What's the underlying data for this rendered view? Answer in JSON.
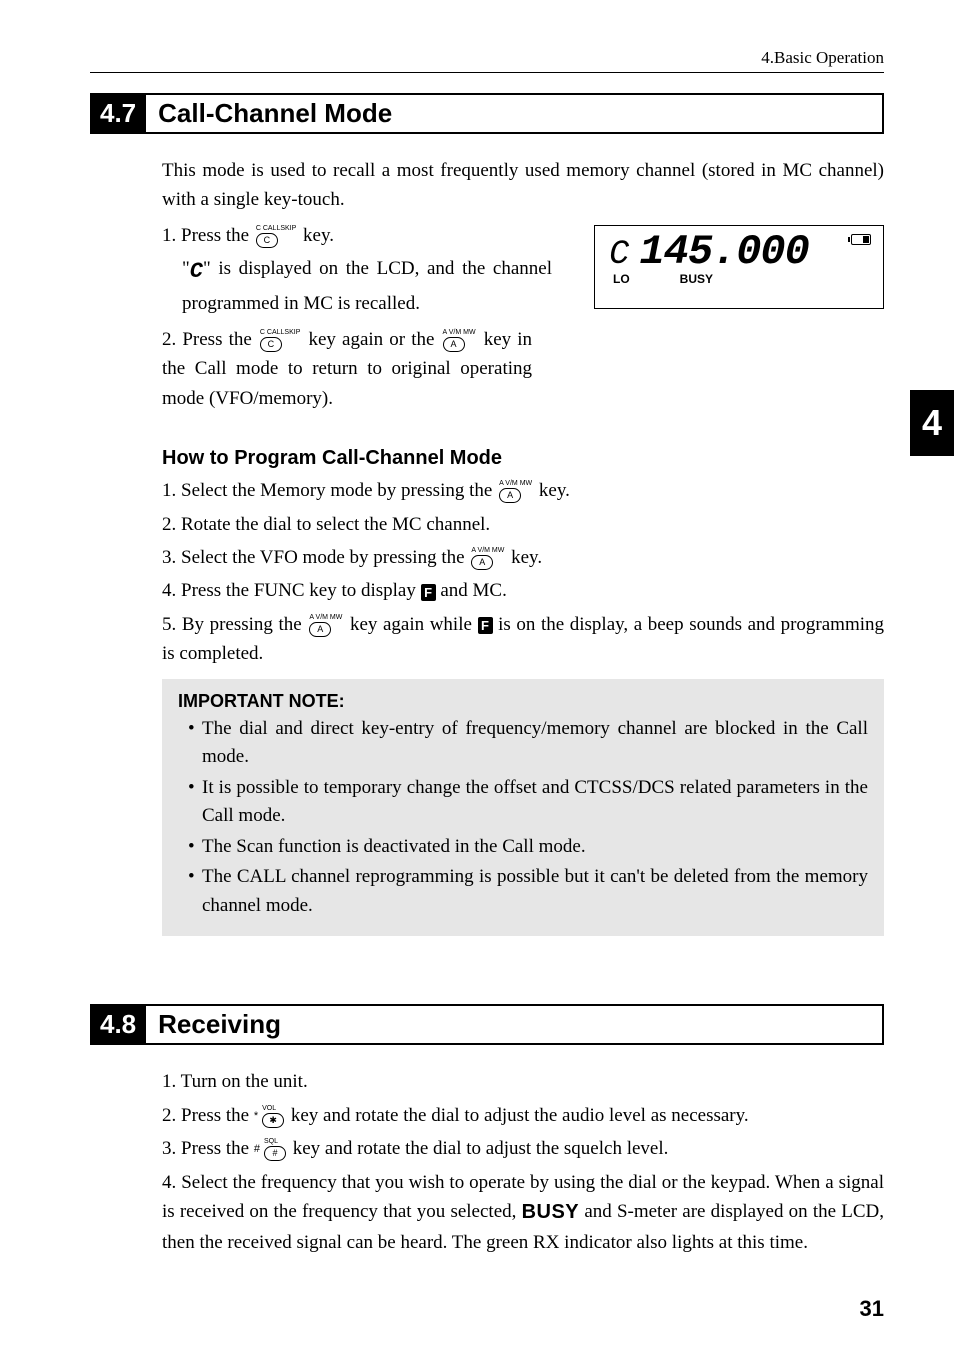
{
  "header": {
    "chapter_ref": "4.Basic Operation"
  },
  "chapter_tab": "4",
  "page_number": "31",
  "s47": {
    "number": "4.7",
    "title": "Call-Channel Mode",
    "intro": "This mode is used to recall a most frequently used memory channel (stored in MC channel) with a single key-touch.",
    "step1_a": "1. Press the ",
    "step1_b": " key.",
    "step1_sub_a": "\"",
    "step1_sub_b": "\" is displayed on the LCD, and the channel programmed in MC is recalled.",
    "step2_a": "2. Press the ",
    "step2_b": " key again or the ",
    "step2_c": " key in the Call mode to return to original operating mode (VFO/memory).",
    "lcd": {
      "c": "C",
      "freq": "145.000",
      "lo": "LO",
      "busy": "BUSY"
    },
    "howto_title": "How to Program Call-Channel Mode",
    "h1_a": "1. Select the Memory mode by pressing the ",
    "h1_b": " key.",
    "h2": "2. Rotate the dial to select the MC channel.",
    "h3_a": "3. Select the VFO mode by pressing the ",
    "h3_b": " key.",
    "h4_a": "4. Press the FUNC key to display ",
    "h4_b": " and MC.",
    "h5_a": "5. By pressing the ",
    "h5_b": " key again while ",
    "h5_c": " is on the display, a beep sounds and programming is completed.",
    "note_title": "IMPORTANT NOTE:",
    "note1": "The dial and direct key-entry of frequency/memory channel are blocked in the Call mode.",
    "note2": "It is possible to temporary change the offset and CTCSS/DCS related parameters in the Call mode.",
    "note3": "The Scan function is deactivated in the Call mode.",
    "note4": "The CALL channel reprogramming is possible but it can't be deleted from the memory channel mode."
  },
  "s48": {
    "number": "4.8",
    "title": "Receiving",
    "r1": "1. Turn on the unit.",
    "r2_a": "2. Press the ",
    "r2_b": " key and rotate the dial to adjust the audio level as necessary.",
    "r3_a": "3. Press the ",
    "r3_b": " key and rotate the dial to adjust the squelch level.",
    "r4_a": "4. Select the frequency that you wish to operate by using the dial or the keypad. When a signal is received on the frequency that you selected, ",
    "r4_b": " and S-meter are displayed on the LCD, then the received signal can be heard.  The green RX indicator also lights at this time.",
    "busy_label": "BUSY"
  },
  "keys": {
    "c_top": "C CALLSKIP",
    "c_inner": "C",
    "a_top": "A V/M MW",
    "a_inner": "A",
    "star_top": "VOL",
    "star_left": "*",
    "star_inner": "✱",
    "hash_top": "SQL",
    "hash_left": "#",
    "hash_inner": "#",
    "f_label": "F",
    "c_glyph": "C"
  }
}
